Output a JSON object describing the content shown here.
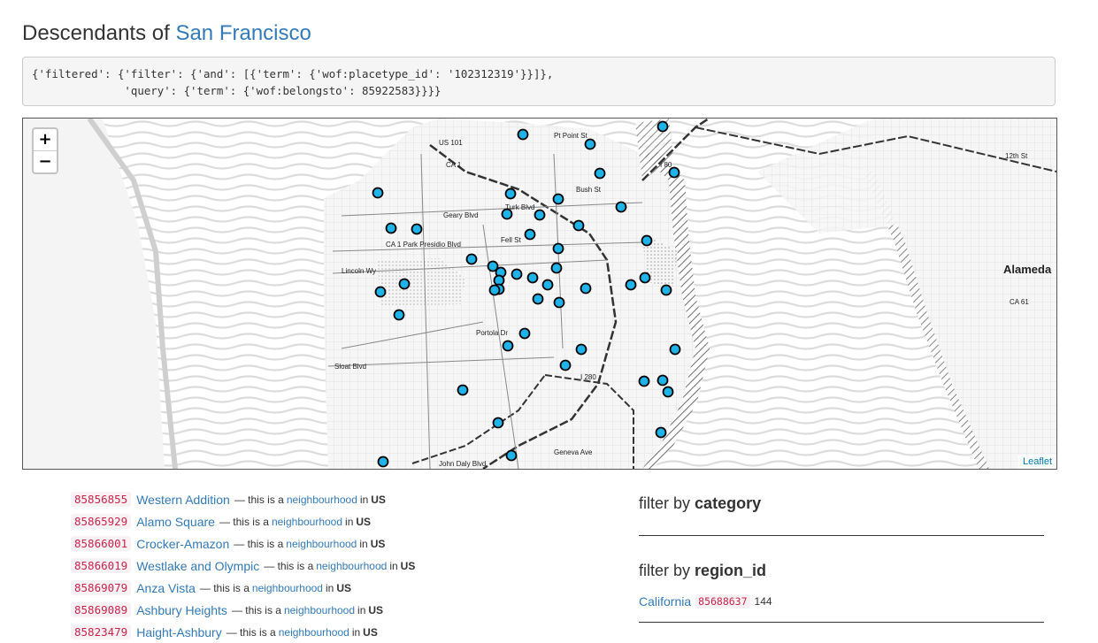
{
  "page": {
    "title_prefix": "Descendants of",
    "title_link": "San Francisco"
  },
  "query": {
    "text": "{'filtered': {'filter': {'and': [{'term': {'wof:placetype_id': '102312319'}}]},\n              'query': {'term': {'wof:belongsto': 85922583}}}}"
  },
  "map": {
    "zoom_in": "+",
    "zoom_out": "−",
    "attribution": "Leaflet",
    "city_label": "Alameda",
    "marker_fill": "#1eb4e9",
    "street_labels": [
      "US 101",
      "CA 1",
      "Bush St",
      "Turk Blvd",
      "Geary Blvd",
      "CA 1 Park Presidio Blvd",
      "Lincoln Wy",
      "Fell St",
      "Portola Dr",
      "Sloat Blvd",
      "I 280",
      "I 80",
      "Geneva Ave",
      "John Daly Blvd",
      "Pt Point St",
      "12th St",
      "CA 61"
    ]
  },
  "results": [
    {
      "id": "85856855",
      "name": "Western Addition",
      "sep": "— this is a",
      "placetype": "neighbourhood",
      "in": "in",
      "country": "US"
    },
    {
      "id": "85865929",
      "name": "Alamo Square",
      "sep": "— this is a",
      "placetype": "neighbourhood",
      "in": "in",
      "country": "US"
    },
    {
      "id": "85866001",
      "name": "Crocker-Amazon",
      "sep": "— this is a",
      "placetype": "neighbourhood",
      "in": "in",
      "country": "US"
    },
    {
      "id": "85866019",
      "name": "Westlake and Olympic",
      "sep": "— this is a",
      "placetype": "neighbourhood",
      "in": "in",
      "country": "US"
    },
    {
      "id": "85869079",
      "name": "Anza Vista",
      "sep": "— this is a",
      "placetype": "neighbourhood",
      "in": "in",
      "country": "US"
    },
    {
      "id": "85869089",
      "name": "Ashbury Heights",
      "sep": "— this is a",
      "placetype": "neighbourhood",
      "in": "in",
      "country": "US"
    },
    {
      "id": "85823479",
      "name": "Haight-Ashbury",
      "sep": "— this is a",
      "placetype": "neighbourhood",
      "in": "in",
      "country": "US"
    }
  ],
  "facets": {
    "filter_by": "filter by",
    "category_label": "category",
    "region_label": "region_id",
    "regions": [
      {
        "name": "California",
        "id": "85688637",
        "count": "144"
      }
    ]
  }
}
